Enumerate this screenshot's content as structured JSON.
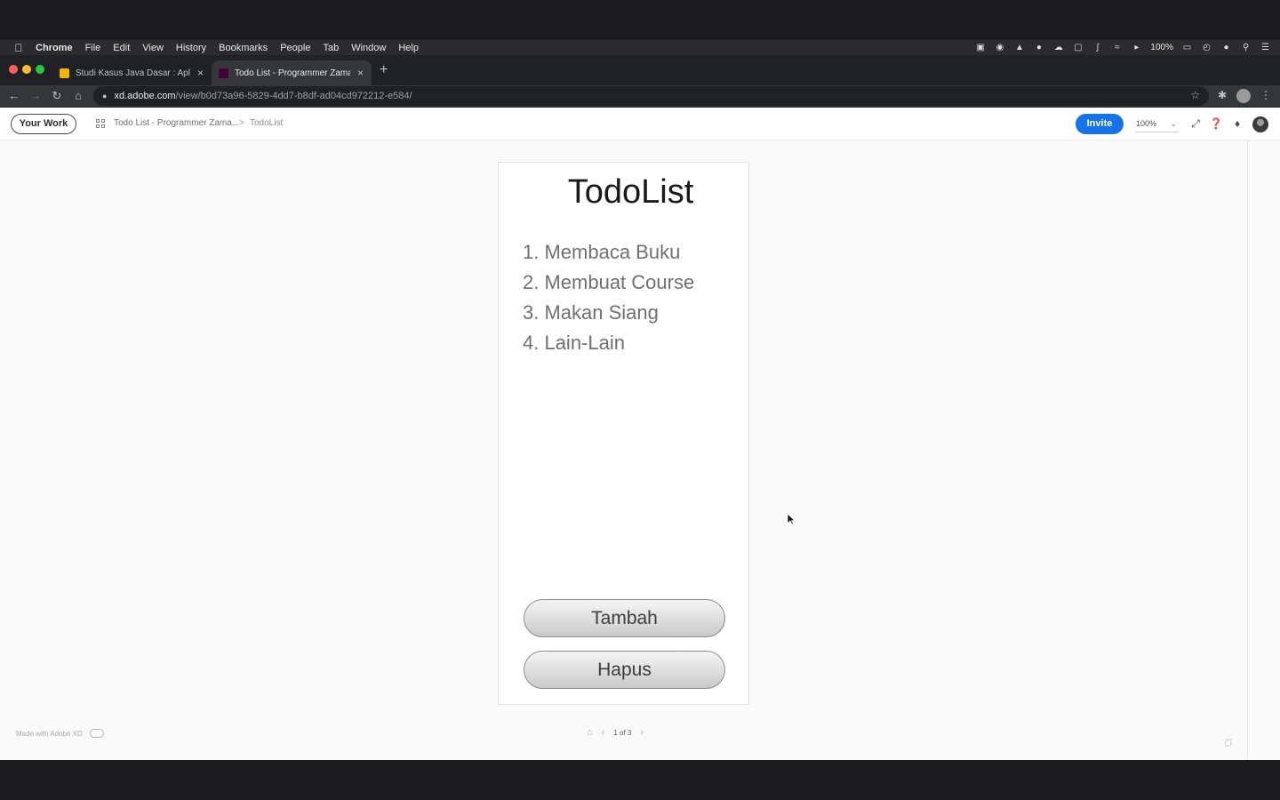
{
  "menubar": {
    "app": "Chrome",
    "items": [
      "File",
      "Edit",
      "View",
      "History",
      "Bookmarks",
      "People",
      "Tab",
      "Window",
      "Help"
    ],
    "battery": "100%"
  },
  "tabs": [
    {
      "label": "Studi Kasus Java Dasar : Aplika",
      "favicon_color": "#f4b400"
    },
    {
      "label": "Todo List - Programmer Zaman",
      "favicon_color": "#470137"
    }
  ],
  "address": {
    "host": "xd.adobe.com",
    "path": "/view/b0d73a96-5829-4dd7-b8df-ad04cd972212-e584/"
  },
  "xd_header": {
    "your_work": "Your Work",
    "breadcrumb_project": "Todo List - Programmer Zama...",
    "breadcrumb_separator": ">",
    "breadcrumb_artboard": "TodoList",
    "invite": "Invite",
    "zoom": "100%"
  },
  "artboard": {
    "title": "TodoList",
    "items": [
      "1. Membaca Buku",
      "2. Membuat Course",
      "3. Makan Siang",
      "4. Lain-Lain"
    ],
    "add_button": "Tambah",
    "delete_button": "Hapus"
  },
  "footer": {
    "made_with": "Made with Adobe XD",
    "page_indicator": "1 of 3"
  },
  "colors": {
    "accent": "#1473e6",
    "close_dot": "#ff5f57",
    "minimize_dot": "#febc2e",
    "zoom_dot": "#28c840"
  }
}
